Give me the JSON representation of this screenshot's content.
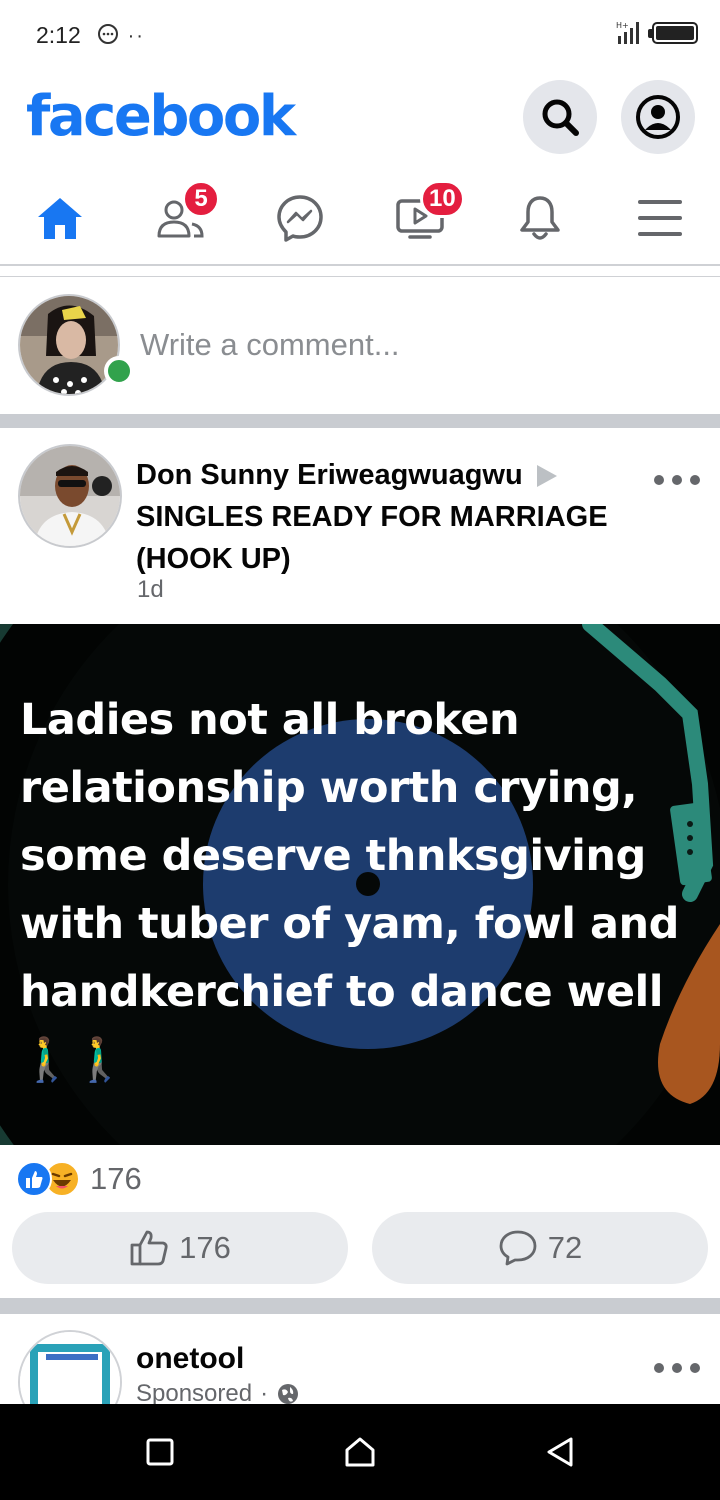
{
  "status_bar": {
    "time": "2:12",
    "extra_icons": "··"
  },
  "header": {
    "logo_text": "facebook",
    "brand_color": "#1877f2"
  },
  "nav": {
    "items": [
      {
        "name": "home",
        "icon": "home-icon",
        "active": true
      },
      {
        "name": "friends",
        "icon": "friends-icon",
        "badge": "5"
      },
      {
        "name": "messenger",
        "icon": "messenger-icon"
      },
      {
        "name": "watch",
        "icon": "watch-icon",
        "badge": "10"
      },
      {
        "name": "notifications",
        "icon": "bell-icon"
      },
      {
        "name": "menu",
        "icon": "hamburger-icon"
      }
    ]
  },
  "composer": {
    "placeholder": "Write a comment..."
  },
  "post": {
    "author": "Don Sunny Eriweagwuagwu",
    "group": "SINGLES READY FOR MARRIAGE (HOOK UP)",
    "time": "1d",
    "text": "Ladies not all broken relationship worth crying, some deserve thnksgiving with tuber of yam, fowl and handkerchief to dance well🚶‍♂️🚶‍♂️",
    "reactions": {
      "types": [
        "like",
        "haha"
      ],
      "count": "176"
    },
    "like_count": "176",
    "comment_count": "72"
  },
  "sponsored_post": {
    "name": "onetool",
    "meta": "Sponsored"
  }
}
